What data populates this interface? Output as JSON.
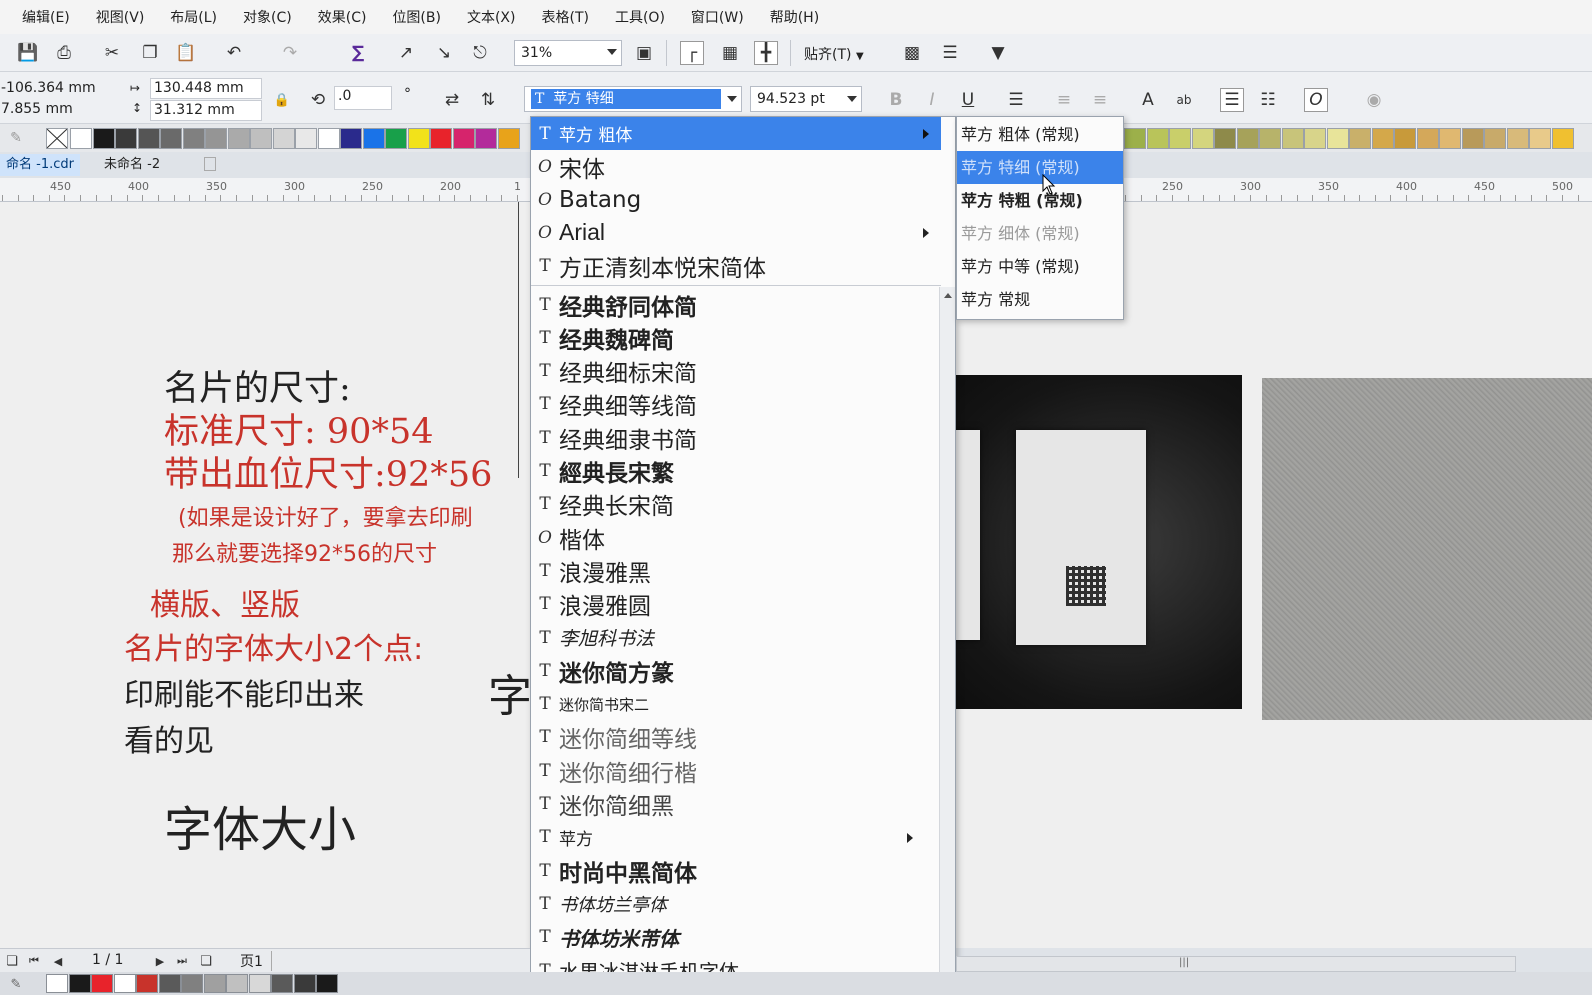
{
  "menu": [
    "编辑(E)",
    "视图(V)",
    "布局(L)",
    "对象(C)",
    "效果(C)",
    "位图(B)",
    "文本(X)",
    "表格(T)",
    "工具(O)",
    "窗口(W)",
    "帮助(H)"
  ],
  "toolbar": {
    "zoom": "31%",
    "snap_label": "贴齐(T)"
  },
  "properties": {
    "x": "-106.364 mm",
    "y": "7.855 mm",
    "width": "130.448 mm",
    "height": "31.312 mm",
    "rotation": ".0",
    "rotation_unit": "°",
    "font_name": "苹方 特细",
    "font_size": "94.523 pt"
  },
  "doc_tabs": [
    "命名 -1.cdr",
    "未命名 -2"
  ],
  "ruler_left": [
    "450",
    "400",
    "350",
    "300",
    "250",
    "200",
    "1"
  ],
  "ruler_right": [
    "250",
    "300",
    "350",
    "400",
    "450",
    "500"
  ],
  "canvas_text": {
    "line1": "名片的尺寸:",
    "line2": "标准尺寸:  90*54",
    "line3": "带出血位尺寸:92*56",
    "line4": "(如果是设计好了，要拿去印刷",
    "line5": "那么就要选择92*56的尺寸",
    "line6": "横版、竖版",
    "line7": "名片的字体大小2个点:",
    "line8": "印刷能不能印出来",
    "line9": "看的见",
    "line10": "字体大小",
    "partial_char": "字"
  },
  "font_list": [
    {
      "type": "T",
      "name": "苹方 粗体",
      "submenu": true,
      "selected": true
    },
    {
      "type": "O",
      "name": "宋体"
    },
    {
      "type": "O",
      "name": "Batang"
    },
    {
      "type": "O",
      "name": "Arial",
      "submenu": true
    },
    {
      "type": "T",
      "name": "方正清刻本悦宋简体"
    },
    {
      "type": "T",
      "name": "经典舒同体简"
    },
    {
      "type": "T",
      "name": "经典魏碑简"
    },
    {
      "type": "T",
      "name": "经典细标宋简"
    },
    {
      "type": "T",
      "name": "经典细等线简"
    },
    {
      "type": "T",
      "name": "经典细隶书简"
    },
    {
      "type": "T",
      "name": "經典長宋繁"
    },
    {
      "type": "T",
      "name": "经典长宋简"
    },
    {
      "type": "O",
      "name": "楷体"
    },
    {
      "type": "T",
      "name": "浪漫雅黑"
    },
    {
      "type": "T",
      "name": "浪漫雅圆"
    },
    {
      "type": "T",
      "name": "李旭科书法"
    },
    {
      "type": "T",
      "name": "迷你简方篆"
    },
    {
      "type": "T",
      "name": "迷你简书宋二"
    },
    {
      "type": "T",
      "name": "迷你简细等线"
    },
    {
      "type": "T",
      "name": "迷你简细行楷"
    },
    {
      "type": "T",
      "name": "迷你简细黑"
    },
    {
      "type": "T",
      "name": "苹方",
      "submenu": true
    },
    {
      "type": "T",
      "name": "时尚中黑简体"
    },
    {
      "type": "T",
      "name": "书体坊兰亭体"
    },
    {
      "type": "T",
      "name": "书体坊米芾体"
    },
    {
      "type": "T",
      "name": "水果冰淇淋手机字体"
    }
  ],
  "submenu": [
    {
      "name": "苹方 粗体 (常规)"
    },
    {
      "name": "苹方 特细 (常规)",
      "highlight": true
    },
    {
      "name": "苹方 特粗 (常规)"
    },
    {
      "name": "苹方 细体 (常规)",
      "dim": true
    },
    {
      "name": "苹方 中等 (常规)"
    },
    {
      "name": "苹方 常规"
    }
  ],
  "pagenav": {
    "count": "1 / 1",
    "page_tab": "页1"
  },
  "colors": {
    "accent": "#3b83ea",
    "red_text": "#c8332b"
  },
  "palette_left": [
    "#ffffff",
    "#1a1a1a",
    "#3a3a3a",
    "#555555",
    "#6a6a6a",
    "#808080",
    "#959595",
    "#aaaaaa",
    "#bfbfbf",
    "#d4d4d4",
    "#e8e8e8",
    "#ffffff",
    "#2a2a8c",
    "#1a73e8",
    "#18a04a",
    "#f2e21a",
    "#e8232b",
    "#d6246c",
    "#b32b9b",
    "#e8a31a"
  ],
  "palette_right": [
    "#9cb04a",
    "#b9c45a",
    "#c9cf6a",
    "#d4d57e",
    "#8e8a4a",
    "#a6a25a",
    "#b7b36a",
    "#c8c47a",
    "#d8d48a",
    "#e8e49a",
    "#c9b06a",
    "#d4a84a",
    "#c89a3a",
    "#d4a85a",
    "#e0b870",
    "#b89a5a",
    "#c8aa6a",
    "#d8ba7a",
    "#e8ca8a",
    "#f0c030"
  ]
}
